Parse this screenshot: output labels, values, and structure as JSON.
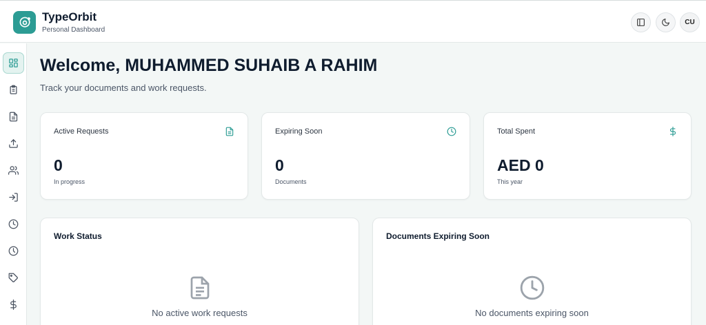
{
  "brand": {
    "name": "TypeOrbit",
    "subtitle": "Personal Dashboard",
    "accent": "#2c9c94"
  },
  "header_actions": [
    {
      "icon": "sidebar-toggle-icon"
    },
    {
      "icon": "moon-icon"
    },
    {
      "avatar_initials": "CU"
    }
  ],
  "sidebar": {
    "items": [
      {
        "icon": "dashboard-grid-icon",
        "active": true
      },
      {
        "icon": "clipboard-icon",
        "active": false
      },
      {
        "icon": "document-icon",
        "active": false
      },
      {
        "icon": "upload-icon",
        "active": false
      },
      {
        "icon": "users-icon",
        "active": false
      },
      {
        "icon": "login-icon",
        "active": false
      },
      {
        "icon": "clock-icon",
        "active": false
      },
      {
        "icon": "history-icon",
        "active": false
      },
      {
        "icon": "tag-icon",
        "active": false
      },
      {
        "icon": "dollar-icon",
        "active": false
      }
    ]
  },
  "main": {
    "welcome": "Welcome, MUHAMMED SUHAIB A RAHIM",
    "subtitle": "Track your documents and work requests.",
    "stats": [
      {
        "label": "Active Requests",
        "value": "0",
        "note": "In progress",
        "icon": "document-icon"
      },
      {
        "label": "Expiring Soon",
        "value": "0",
        "note": "Documents",
        "icon": "clock-icon"
      },
      {
        "label": "Total Spent",
        "value": "AED 0",
        "note": "This year",
        "icon": "dollar-icon"
      }
    ],
    "panels": [
      {
        "title": "Work Status",
        "empty_text": "No active work requests",
        "icon": "document-icon"
      },
      {
        "title": "Documents Expiring Soon",
        "empty_text": "No documents expiring soon",
        "icon": "clock-icon"
      }
    ]
  }
}
